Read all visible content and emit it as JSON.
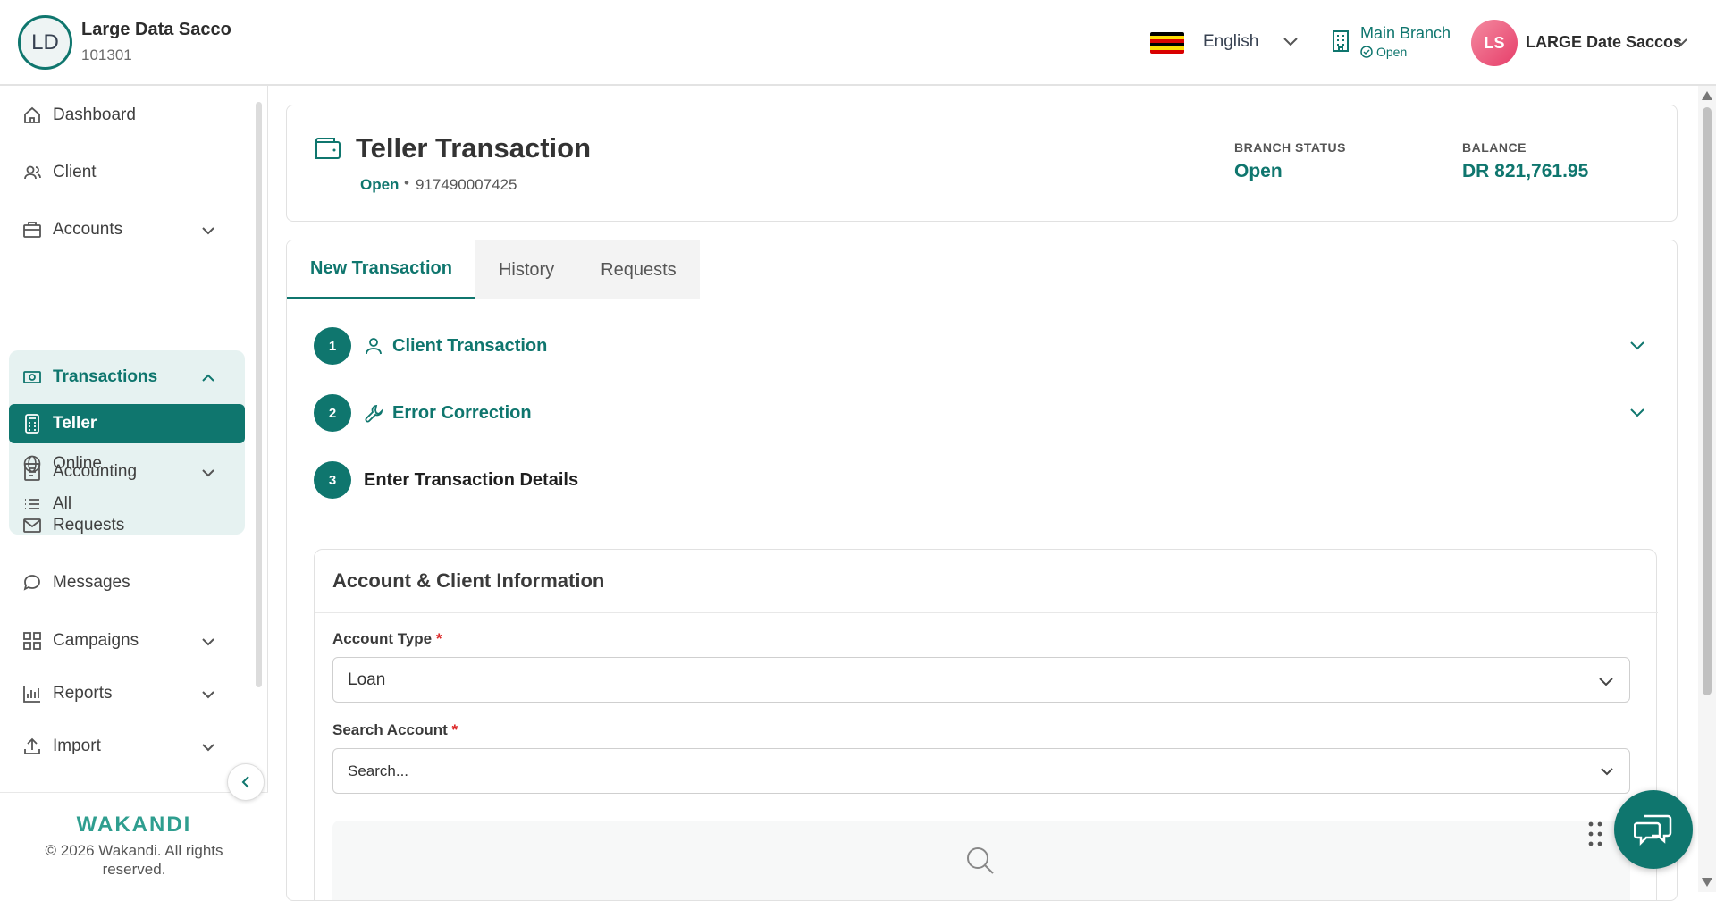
{
  "header": {
    "logo_initials": "LD",
    "org_name": "Large Data Sacco",
    "org_code": "101301",
    "language": "English",
    "branch_name": "Main Branch",
    "branch_status": "Open",
    "user_initials": "LS",
    "user_name": "LARGE Date Saccos"
  },
  "sidebar": {
    "items": [
      {
        "label": "Dashboard",
        "icon": "home-icon"
      },
      {
        "label": "Client",
        "icon": "users-icon"
      },
      {
        "label": "Accounts",
        "icon": "briefcase-icon"
      },
      {
        "label": "Transactions",
        "icon": "cash-icon"
      },
      {
        "label": "Accounting",
        "icon": "ledger-icon"
      },
      {
        "label": "Requests",
        "icon": "mail-icon"
      },
      {
        "label": "Messages",
        "icon": "chat-icon"
      },
      {
        "label": "Campaigns",
        "icon": "grid-icon"
      },
      {
        "label": "Reports",
        "icon": "bar-chart-icon"
      },
      {
        "label": "Import",
        "icon": "upload-icon"
      }
    ],
    "transactions_sub": [
      {
        "label": "Teller",
        "icon": "calculator-icon"
      },
      {
        "label": "Online",
        "icon": "globe-icon"
      },
      {
        "label": "All",
        "icon": "list-icon"
      }
    ],
    "footer_brand": "WAKANDI",
    "footer_copy": "© 2026 Wakandi. All rights reserved."
  },
  "page": {
    "title": "Teller Transaction",
    "status": "Open",
    "separator": "•",
    "teller_number": "917490007425",
    "branch_status_label": "BRANCH STATUS",
    "branch_status_value": "Open",
    "balance_label": "BALANCE",
    "balance_value": "DR 821,761.95"
  },
  "tabs": [
    "New Transaction",
    "History",
    "Requests"
  ],
  "steps": [
    {
      "num": "1",
      "label": "Client Transaction"
    },
    {
      "num": "2",
      "label": "Error Correction"
    },
    {
      "num": "3",
      "label": "Enter Transaction Details"
    }
  ],
  "form": {
    "title": "Account & Client Information",
    "account_type_label": "Account Type",
    "account_type_value": "Loan",
    "search_label": "Search Account",
    "search_placeholder": "Search...",
    "required_mark": "*"
  },
  "colors": {
    "accent": "#0f766e",
    "active_bg": "#e6f2f1",
    "avatar": "#e63e6a"
  }
}
